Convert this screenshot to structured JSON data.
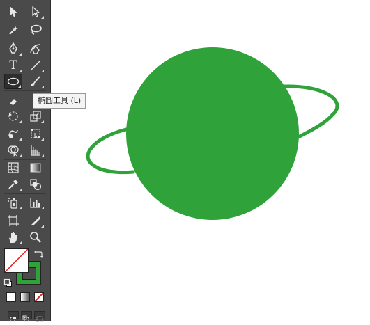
{
  "tooltip": {
    "text": "椭圆工具 (L)"
  },
  "tools": [
    {
      "name": "selection-tool",
      "icon": "arrow-black-icon"
    },
    {
      "name": "direct-selection-tool",
      "icon": "arrow-white-icon"
    },
    {
      "name": "magic-wand-tool",
      "icon": "magic-wand-icon"
    },
    {
      "name": "lasso-tool",
      "icon": "lasso-icon"
    },
    {
      "name": "pen-tool",
      "icon": "pen-icon"
    },
    {
      "name": "curvature-tool",
      "icon": "curvature-pen-icon"
    },
    {
      "name": "type-tool",
      "icon": "type-icon",
      "glyph": "T"
    },
    {
      "name": "line-segment-tool",
      "icon": "line-icon"
    },
    {
      "name": "ellipse-tool",
      "icon": "ellipse-icon",
      "active": true
    },
    {
      "name": "paintbrush-tool",
      "icon": "brush-icon"
    },
    {
      "name": "rotate-tool",
      "icon": "rotate-icon"
    },
    {
      "name": "scale-tool",
      "icon": "scale-icon"
    },
    {
      "name": "warp-tool",
      "icon": "warp-icon"
    },
    {
      "name": "free-transform-tool",
      "icon": "free-transform-icon"
    },
    {
      "name": "shape-builder-tool",
      "icon": "shape-builder-icon"
    },
    {
      "name": "perspective-grid-tool",
      "icon": "perspective-grid-icon"
    },
    {
      "name": "mesh-tool",
      "icon": "mesh-icon"
    },
    {
      "name": "gradient-tool",
      "icon": "gradient-icon"
    },
    {
      "name": "eyedropper-tool",
      "icon": "eyedropper-icon"
    },
    {
      "name": "blend-tool",
      "icon": "blend-icon"
    },
    {
      "name": "symbol-sprayer-tool",
      "icon": "symbol-sprayer-icon"
    },
    {
      "name": "column-graph-tool",
      "icon": "column-graph-icon"
    },
    {
      "name": "artboard-tool",
      "icon": "artboard-icon"
    },
    {
      "name": "slice-tool",
      "icon": "slice-icon"
    },
    {
      "name": "hand-tool",
      "icon": "hand-icon"
    },
    {
      "name": "zoom-tool",
      "icon": "zoom-icon"
    }
  ],
  "colors": {
    "toolbar_bg": "#4a4a4a",
    "planet_fill": "#2fa33a",
    "ring_stroke": "#2fa33a",
    "stroke_swatch": "#2fa33a",
    "fill_swatch": "#ffffff",
    "none_slash": "#e02020"
  },
  "color_modes": [
    "color",
    "gradient",
    "none"
  ],
  "canvas": {
    "objects": [
      "planet-circle",
      "planet-ring"
    ]
  }
}
